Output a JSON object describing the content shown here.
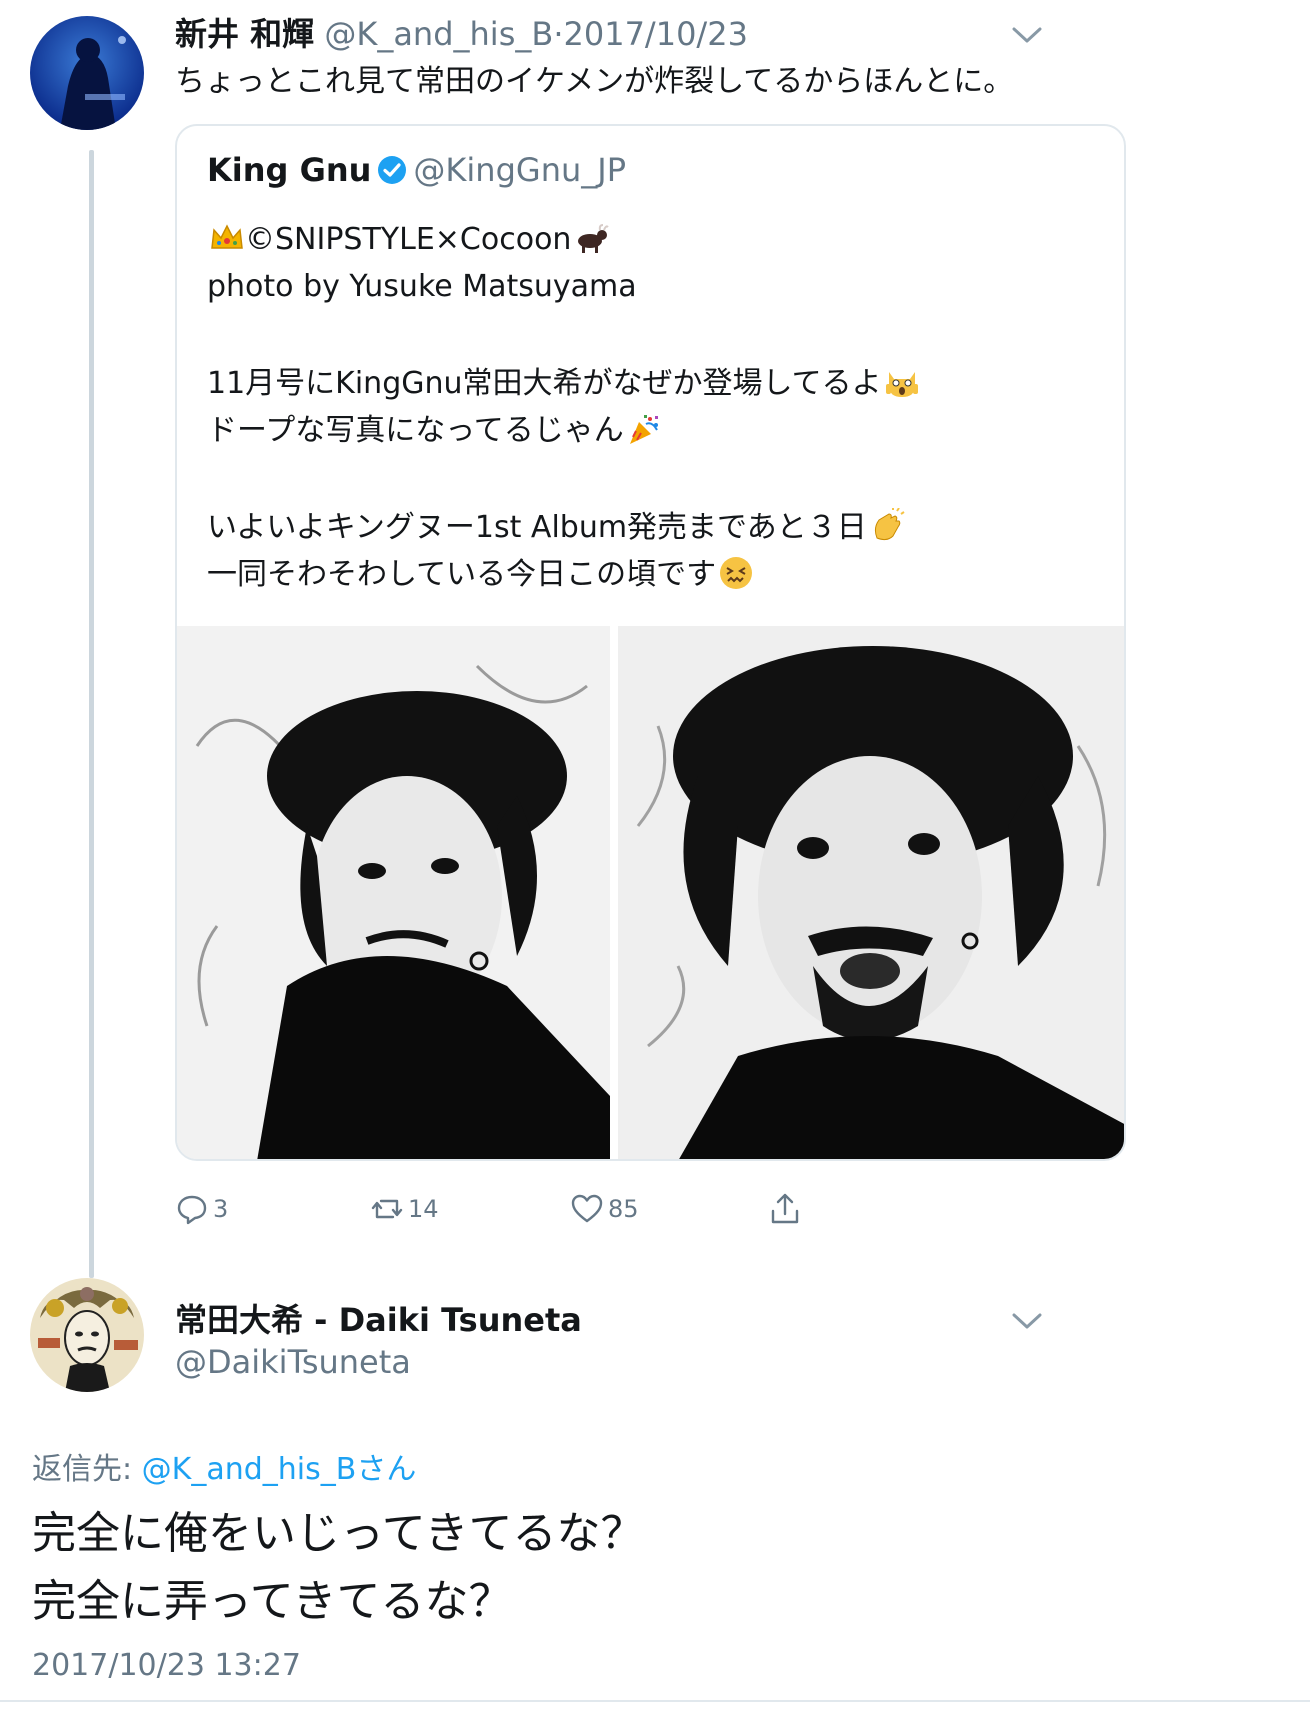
{
  "tweet": {
    "author_name": "新井 和輝",
    "author_handle": "@K_and_his_B",
    "separator": "·",
    "date": "2017/10/23",
    "text": "ちょっとこれ見て常田のイケメンが炸裂してるからほんとに。"
  },
  "quoted_tweet": {
    "author_name": "King Gnu",
    "author_handle": "@KingGnu_JP",
    "lines": [
      "©SNIPSTYLE×Cocoon",
      "photo by Yusuke Matsuyama",
      "11月号にKingGnu常田大希がなぜか登場してるよ",
      "ドープな写真になってるじゃん",
      "いよいよキングヌー1st Album発売まであと３日",
      "一同そわそわしている今日この頃です"
    ],
    "emojis": [
      "crown-emoji",
      "ox-emoji",
      "screaming-cat-emoji",
      "party-popper-emoji",
      "clapping-hands-emoji",
      "confounded-face-emoji"
    ]
  },
  "actions": {
    "replies": "3",
    "retweets": "14",
    "likes": "85"
  },
  "reply": {
    "author_name": "常田大希 - Daiki Tsuneta",
    "author_handle": "@DaikiTsuneta",
    "replying_label": "返信先:",
    "replying_mention": "@K_and_his_Bさん",
    "text_line1": "完全に俺をいじってきてるな？",
    "text_line2": "完全に弄ってきてるな？",
    "timestamp": "2017/10/23 13:27"
  },
  "colors": {
    "link": "#1da1f2",
    "muted": "#657786",
    "border": "#e1e8ed",
    "thread_line": "#ccd6dd"
  }
}
